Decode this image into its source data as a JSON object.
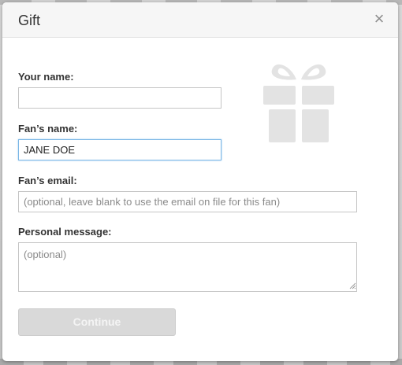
{
  "dialog": {
    "title": "Gift",
    "close_symbol": "×"
  },
  "form": {
    "your_name": {
      "label": "Your name:",
      "value": "",
      "placeholder": ""
    },
    "fan_name": {
      "label": "Fan’s name:",
      "value": "JANE DOE"
    },
    "fan_email": {
      "label": "Fan’s email:",
      "value": "",
      "placeholder": "(optional, leave blank to use the email on file for this fan)"
    },
    "personal_message": {
      "label": "Personal message:",
      "value": "",
      "placeholder": "(optional)"
    }
  },
  "actions": {
    "continue_label": "Continue"
  },
  "icons": {
    "decoration": "gift-icon",
    "close": "close-icon",
    "resize": "resize-grip-icon"
  },
  "colors": {
    "focus_border": "#7cb7e6",
    "disabled_button": "#d9d9d9",
    "icon_gray": "#e3e3e3"
  }
}
